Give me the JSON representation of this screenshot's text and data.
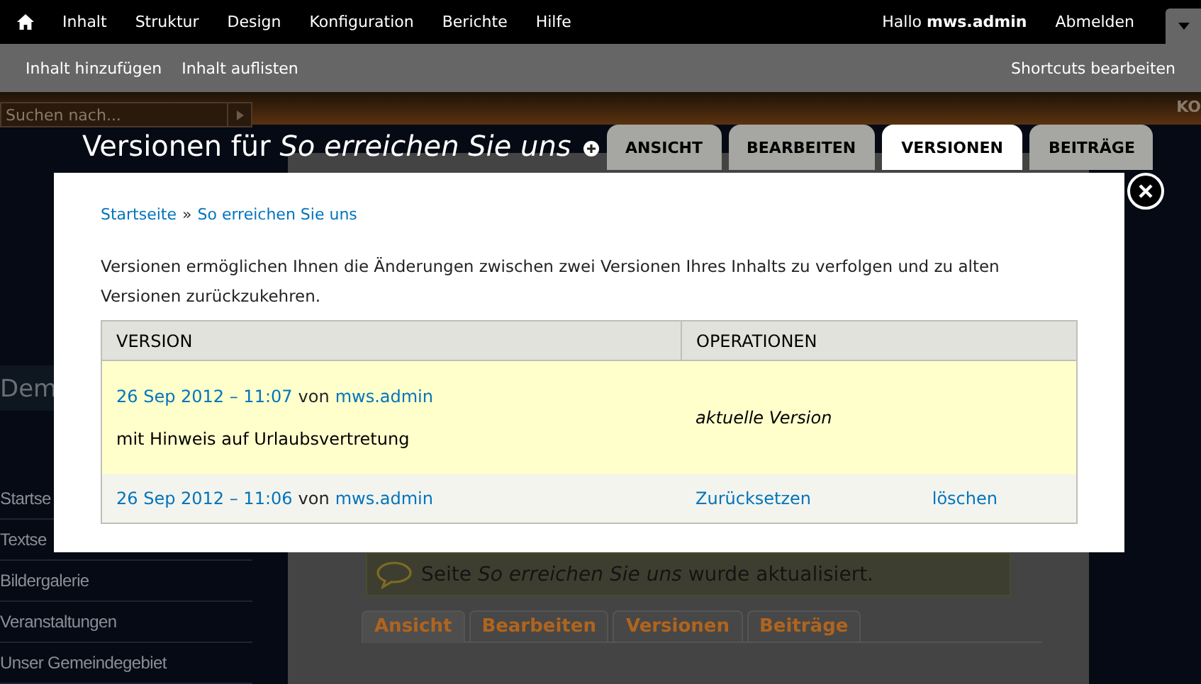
{
  "toolbar": {
    "menu": [
      "Inhalt",
      "Struktur",
      "Design",
      "Konfiguration",
      "Berichte",
      "Hilfe"
    ],
    "greeting": "Hallo",
    "user": "mws.admin",
    "logout": "Abmelden"
  },
  "shortcuts": {
    "items": [
      "Inhalt hinzufügen",
      "Inhalt auflisten"
    ],
    "edit": "Shortcuts bearbeiten"
  },
  "page": {
    "search": {
      "placeholder": "Suchen nach..."
    },
    "header_cut_text": "KO",
    "sidebar": {
      "title": "Dem",
      "items": [
        "Startse",
        "Textse",
        "Bildergalerie",
        "Veranstaltungen",
        "Unser Gemeindegebiet"
      ]
    },
    "message": "Seite *So erreichen Sie uns* wurde aktualisiert.",
    "tabs": [
      {
        "label": "Ansicht",
        "selected": true
      },
      {
        "label": "Bearbeiten",
        "selected": false
      },
      {
        "label": "Versionen",
        "selected": false
      },
      {
        "label": "Beiträge",
        "selected": false
      }
    ]
  },
  "overlay": {
    "title": "Versionen für *So erreichen Sie uns*",
    "tabs": [
      {
        "label": "ANSICHT",
        "selected": false
      },
      {
        "label": "BEARBEITEN",
        "selected": false
      },
      {
        "label": "VERSIONEN",
        "selected": true
      },
      {
        "label": "BEITRÄGE",
        "selected": false
      }
    ],
    "breadcrumb": [
      "Startseite",
      "So erreichen Sie uns"
    ],
    "breadcrumb_separator": "»",
    "description": "Versionen ermöglichen Ihnen die Änderungen zwischen zwei Versionen Ihres Inhalts zu verfolgen und zu alten Versionen zurückzukehren.",
    "table": {
      "columns": [
        "VERSION",
        "OPERATIONEN"
      ],
      "rows": [
        {
          "date": "26 Sep 2012 – 11:07",
          "by": "von",
          "author": "mws.admin",
          "note": "mit Hinweis auf Urlaubsvertretung",
          "current": true,
          "status": "aktuelle Version"
        },
        {
          "date": "26 Sep 2012 – 11:06",
          "by": "von",
          "author": "mws.admin",
          "current": false,
          "operations": [
            "Zurücksetzen",
            "löschen"
          ]
        }
      ]
    }
  }
}
